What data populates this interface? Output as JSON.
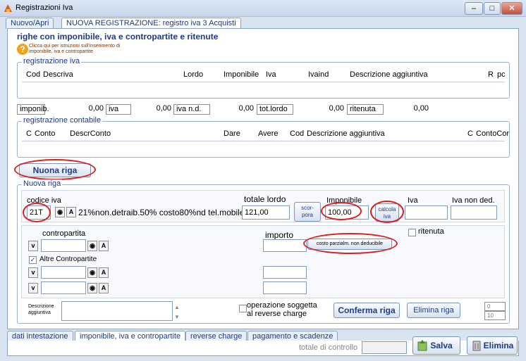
{
  "window": {
    "title": "Registrazioni Iva"
  },
  "top_tabs": [
    "Nuovo/Apri",
    "NUOVA REGISTRAZIONE: registro iva 3 Acquisti"
  ],
  "section_title": "righe con imponibile, iva e contropartite e ritenute",
  "help": {
    "text": "Clicca qui per istruzioni sull'inserimento di imponibile, iva e contropartite"
  },
  "reg_iva": {
    "legend": "registrazione iva",
    "columns": [
      "Cod",
      "Descriva",
      "Lordo",
      "Imponibile",
      "Iva",
      "Ivaind",
      "Descrizione aggiuntiva",
      "R",
      "pc"
    ]
  },
  "totals": {
    "imponib_label": "imponib.",
    "imponib_value": "0,00",
    "iva_label": "iva",
    "iva_value": "0,00",
    "ivand_label": "iva n.d.",
    "ivand_value": "0,00",
    "totlordo_label": "tot.lordo",
    "totlordo_value": "0,00",
    "ritenuta_label": "ritenuta",
    "ritenuta_value": "0,00"
  },
  "reg_contabile": {
    "legend": "registrazione contabile",
    "columns": [
      "C",
      "Conto",
      "DescrConto",
      "Dare",
      "Avere",
      "Cod",
      "Descrizione aggiuntiva",
      "C",
      "ContoCor"
    ]
  },
  "nuova_riga_button": "Nuona riga",
  "nuova_riga": {
    "legend": "Nuova riga",
    "codice_iva_label": "codice iva",
    "codice_iva_value": "21T",
    "codice_iva_desc": "21%non.detraib.50% costo80%nd tel.mobile",
    "totale_lordo_label": "totale lordo",
    "totale_lordo_value": "121,00",
    "scorpora_button": "scor-\npora",
    "imponibile_label": "Imponibile",
    "imponibile_value": "100,00",
    "calcola_iva_button": "calcola\niva",
    "iva_label": "Iva",
    "iva_non_ded_label": "Iva non ded.",
    "contropartita_label": "contropartita",
    "importo_label": "importo",
    "costo_button": "costo parzialm. non deducibile",
    "ritenuta_label": "ritenuta",
    "altre_label": "Altre Contropartite",
    "descr_label": "Descrizione aggiuntiva",
    "reverse_label": "operazione soggetta al reverse charge",
    "conferma_button": "Conferma riga",
    "elimina_riga_button": "Elimina riga",
    "counter_top": "0",
    "counter_bottom": "10"
  },
  "bottom_tabs": [
    "dati intestazione",
    "imponibile, iva e contropartite",
    "reverse charge",
    "pagamento e scadenze"
  ],
  "footer": {
    "totale_controllo_label": "totale di controllo",
    "salva_button": "Salva",
    "elimina_button": "Elimina"
  },
  "colors": {
    "accent": "#1d3a8a",
    "highlight": "#d92020"
  }
}
